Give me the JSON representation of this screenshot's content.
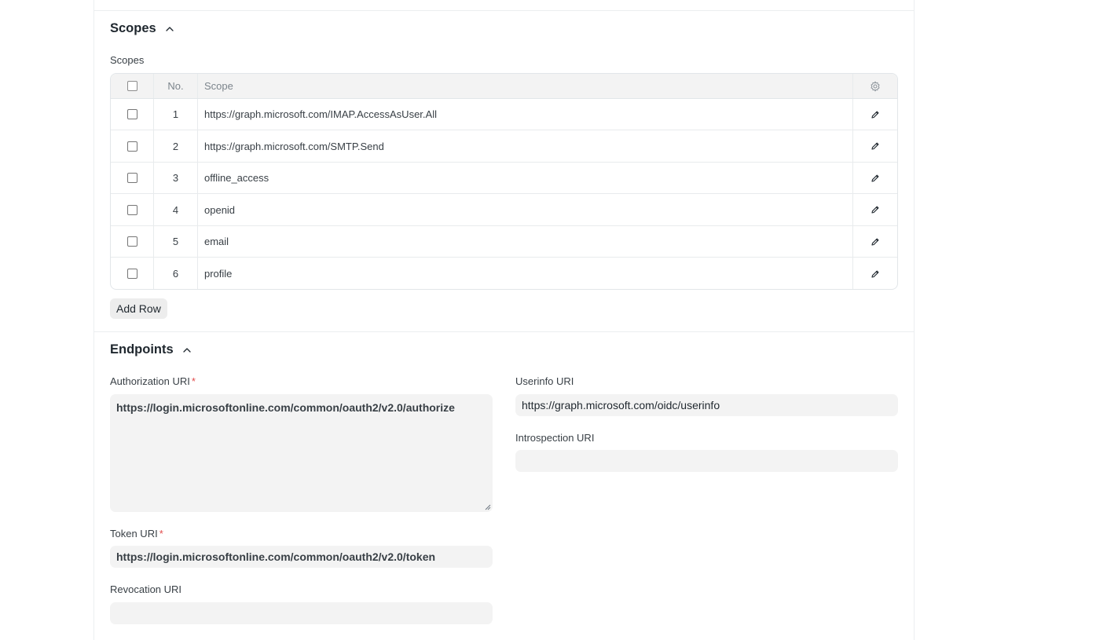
{
  "scopes_section": {
    "title": "Scopes",
    "field_label": "Scopes",
    "table": {
      "columns": {
        "no": "No.",
        "scope": "Scope"
      },
      "rows": [
        {
          "no": "1",
          "scope": "https://graph.microsoft.com/IMAP.AccessAsUser.All"
        },
        {
          "no": "2",
          "scope": "https://graph.microsoft.com/SMTP.Send"
        },
        {
          "no": "3",
          "scope": "offline_access"
        },
        {
          "no": "4",
          "scope": "openid"
        },
        {
          "no": "5",
          "scope": "email"
        },
        {
          "no": "6",
          "scope": "profile"
        }
      ]
    },
    "add_row_label": "Add Row"
  },
  "endpoints_section": {
    "title": "Endpoints",
    "authorization_uri": {
      "label": "Authorization URI",
      "required_mark": "*",
      "value": "https://login.microsoftonline.com/common/oauth2/v2.0/authorize"
    },
    "token_uri": {
      "label": "Token URI",
      "required_mark": "*",
      "value": "https://login.microsoftonline.com/common/oauth2/v2.0/token"
    },
    "revocation_uri": {
      "label": "Revocation URI",
      "value": ""
    },
    "userinfo_uri": {
      "label": "Userinfo URI",
      "value": "https://graph.microsoft.com/oidc/userinfo"
    },
    "introspection_uri": {
      "label": "Introspection URI",
      "value": ""
    }
  },
  "colors": {
    "required": "#e24c4c",
    "input_bg": "#f3f3f3",
    "border": "#e2e6e9"
  },
  "icons": [
    "chevron-up-icon",
    "settings-gear-icon",
    "edit-pencil-icon"
  ]
}
